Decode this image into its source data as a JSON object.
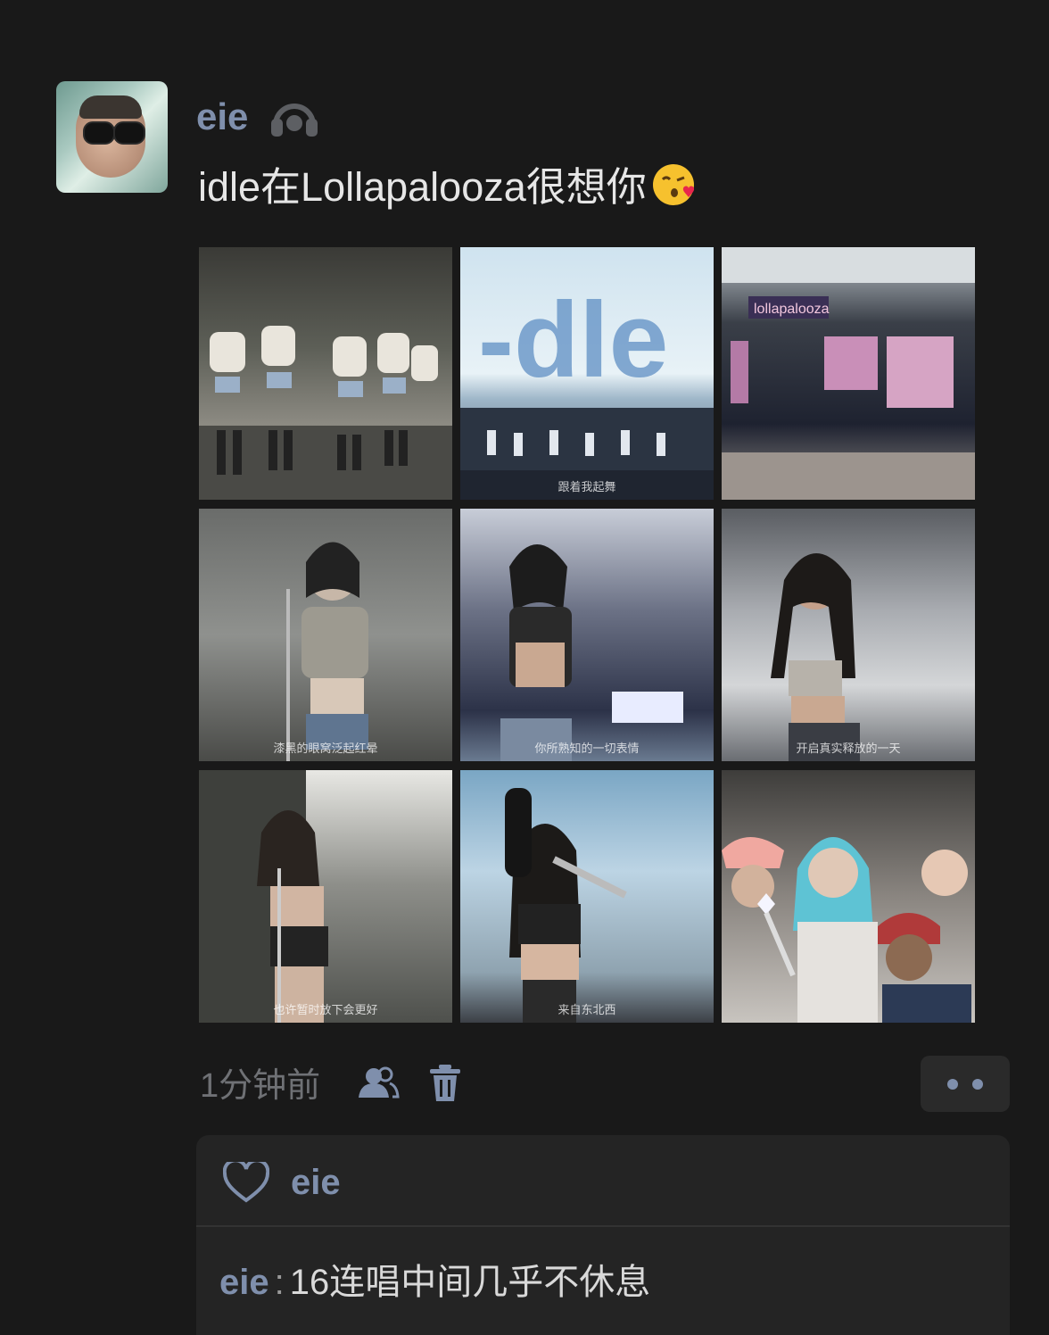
{
  "post": {
    "username": "eie",
    "text": "idle在Lollapalooza很想你",
    "emoji": "kissing-face-with-heart",
    "time": "1分钟前",
    "photos": [
      {
        "name": "photo-group-stage",
        "caption": ""
      },
      {
        "name": "photo-idle-screen",
        "caption": "跟着我起舞"
      },
      {
        "name": "photo-lollapalooza-stage",
        "caption": ""
      },
      {
        "name": "photo-singer-1",
        "caption": "漆黑的眼窝泛起红晕"
      },
      {
        "name": "photo-singer-2",
        "caption": "你所熟知的一切表情"
      },
      {
        "name": "photo-singer-3",
        "caption": "开启真实释放的一天"
      },
      {
        "name": "photo-singer-4",
        "caption": "也许暂时放下会更好"
      },
      {
        "name": "photo-singer-5",
        "caption": "来自东北西"
      },
      {
        "name": "photo-fans",
        "caption": ""
      }
    ]
  },
  "likes": {
    "users": "eie"
  },
  "comment": {
    "user": "eie",
    "separator": ":",
    "text": "16连唱中间几乎不休息"
  },
  "colors": {
    "background": "#191919",
    "username": "#7f8fac",
    "panel": "#242424"
  }
}
